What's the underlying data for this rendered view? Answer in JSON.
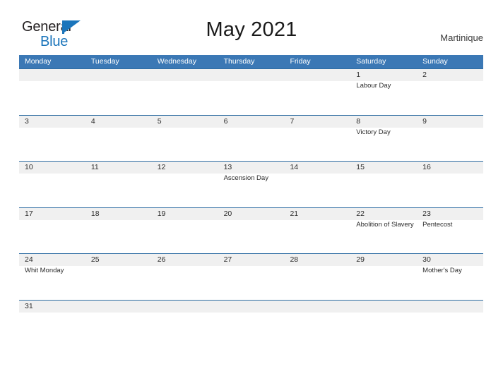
{
  "brand": {
    "name_part1": "General",
    "name_part2": "Blue",
    "flag_icon": "blue-triangle-flag-icon",
    "color_primary": "#1b75bb",
    "color_text": "#231f20"
  },
  "header": {
    "title": "May 2021",
    "location": "Martinique"
  },
  "theme": {
    "header_blue": "#3b78b5",
    "rule_blue": "#2d6ca2",
    "band_gray": "#f0f0f0",
    "text_dark": "#2b2b2b"
  },
  "calendar": {
    "month": "May",
    "year": "2021",
    "weekdays": [
      "Monday",
      "Tuesday",
      "Wednesday",
      "Thursday",
      "Friday",
      "Saturday",
      "Sunday"
    ],
    "weeks": [
      [
        {
          "date": "",
          "event": ""
        },
        {
          "date": "",
          "event": ""
        },
        {
          "date": "",
          "event": ""
        },
        {
          "date": "",
          "event": ""
        },
        {
          "date": "",
          "event": ""
        },
        {
          "date": "1",
          "event": "Labour Day"
        },
        {
          "date": "2",
          "event": ""
        }
      ],
      [
        {
          "date": "3",
          "event": ""
        },
        {
          "date": "4",
          "event": ""
        },
        {
          "date": "5",
          "event": ""
        },
        {
          "date": "6",
          "event": ""
        },
        {
          "date": "7",
          "event": ""
        },
        {
          "date": "8",
          "event": "Victory Day"
        },
        {
          "date": "9",
          "event": ""
        }
      ],
      [
        {
          "date": "10",
          "event": ""
        },
        {
          "date": "11",
          "event": ""
        },
        {
          "date": "12",
          "event": ""
        },
        {
          "date": "13",
          "event": "Ascension Day"
        },
        {
          "date": "14",
          "event": ""
        },
        {
          "date": "15",
          "event": ""
        },
        {
          "date": "16",
          "event": ""
        }
      ],
      [
        {
          "date": "17",
          "event": ""
        },
        {
          "date": "18",
          "event": ""
        },
        {
          "date": "19",
          "event": ""
        },
        {
          "date": "20",
          "event": ""
        },
        {
          "date": "21",
          "event": ""
        },
        {
          "date": "22",
          "event": "Abolition of Slavery"
        },
        {
          "date": "23",
          "event": "Pentecost"
        }
      ],
      [
        {
          "date": "24",
          "event": "Whit Monday"
        },
        {
          "date": "25",
          "event": ""
        },
        {
          "date": "26",
          "event": ""
        },
        {
          "date": "27",
          "event": ""
        },
        {
          "date": "28",
          "event": ""
        },
        {
          "date": "29",
          "event": ""
        },
        {
          "date": "30",
          "event": "Mother's Day"
        }
      ],
      [
        {
          "date": "31",
          "event": ""
        },
        {
          "date": "",
          "event": ""
        },
        {
          "date": "",
          "event": ""
        },
        {
          "date": "",
          "event": ""
        },
        {
          "date": "",
          "event": ""
        },
        {
          "date": "",
          "event": ""
        },
        {
          "date": "",
          "event": ""
        }
      ]
    ]
  }
}
